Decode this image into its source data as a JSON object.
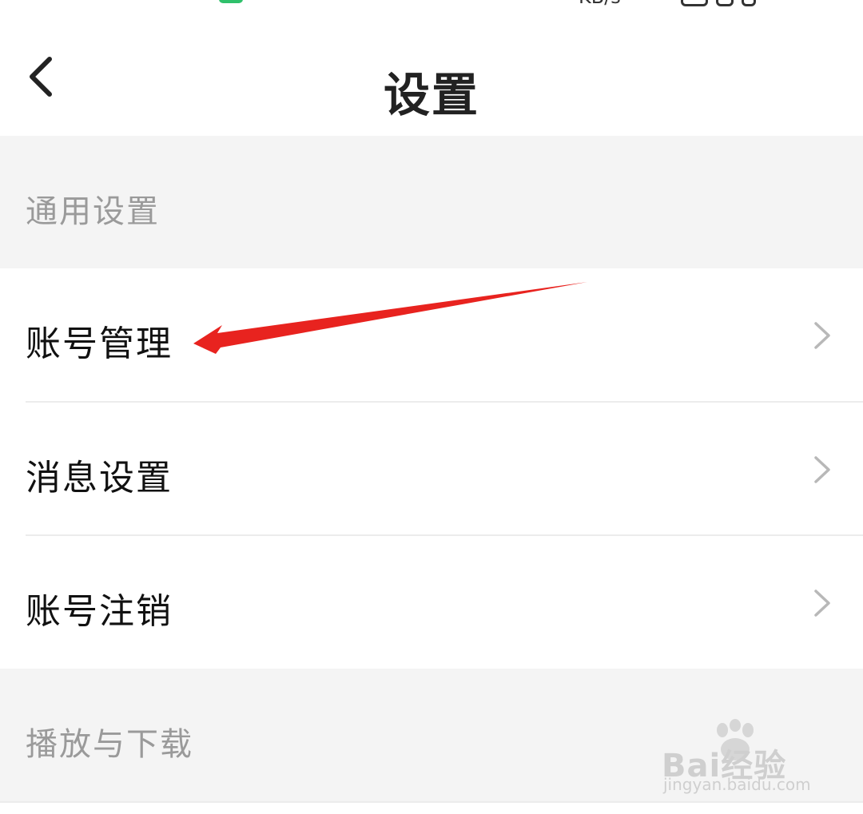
{
  "statusbar": {
    "speed_text": "KB/s"
  },
  "header": {
    "title": "设置"
  },
  "sections": [
    {
      "header": "通用设置",
      "items": [
        "账号管理",
        "消息设置",
        "账号注销"
      ]
    },
    {
      "header": "播放与下载"
    }
  ],
  "watermark": {
    "brand": "Bai经验",
    "url": "jingyan.baidu.com"
  },
  "colors": {
    "annotation_arrow": "#e8231f",
    "section_bg": "#f4f4f4",
    "status_green": "#2fc06b"
  }
}
